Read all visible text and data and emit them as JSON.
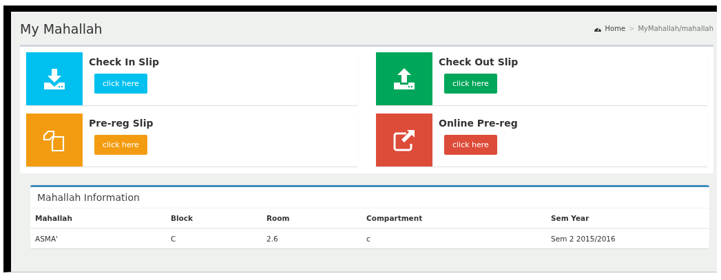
{
  "header": {
    "title": "My Mahallah",
    "breadcrumb": [
      {
        "label": "Home"
      },
      {
        "label": "MyMahallah/mahallah"
      }
    ],
    "separator": ">"
  },
  "slips": [
    {
      "kind": "download",
      "title": "Check In Slip",
      "button": "click here",
      "color": "#00c0ef"
    },
    {
      "kind": "upload",
      "title": "Check Out Slip",
      "button": "click here",
      "color": "#00a65a"
    },
    {
      "kind": "copy",
      "title": "Pre-reg Slip",
      "button": "click here",
      "color": "#f39c12"
    },
    {
      "kind": "external",
      "title": "Online Pre-reg",
      "button": "click here",
      "color": "#dd4b39"
    }
  ],
  "info": {
    "title": "Mahallah Information",
    "columns": [
      "Mahallah",
      "Block",
      "Room",
      "Compartment",
      "Sem Year"
    ],
    "rows": [
      [
        "ASMA'",
        "C",
        "2.6",
        "c",
        "Sem 2 2015/2016"
      ]
    ]
  }
}
